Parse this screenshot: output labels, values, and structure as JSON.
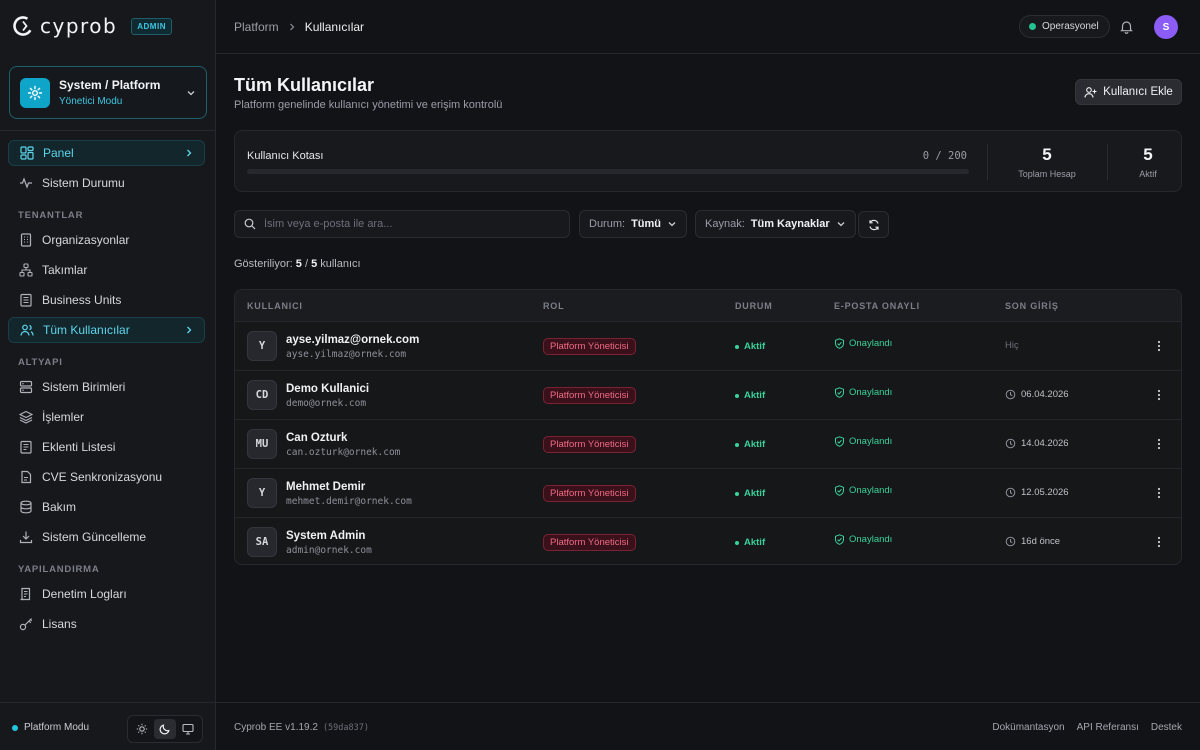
{
  "brand": {
    "name": "cyprob",
    "badge": "ADMIN"
  },
  "context": {
    "title": "System / Platform",
    "subtitle": "Yönetici Modu",
    "icon": "gear-icon"
  },
  "nav": {
    "panel": "Panel",
    "system_status": "Sistem Durumu",
    "sections": {
      "tenants": "TENANTLAR",
      "infra": "ALTYAPI",
      "config": "YAPILANDIRMA"
    },
    "organizations": "Organizasyonlar",
    "teams": "Takımlar",
    "business_units": "Business Units",
    "all_users": "Tüm Kullanıcılar",
    "system_units": "Sistem Birimleri",
    "jobs": "İşlemler",
    "plugins": "Eklenti Listesi",
    "cve_sync": "CVE Senkronizasyonu",
    "maintenance": "Bakım",
    "system_update": "Sistem Güncelleme",
    "audit_logs": "Denetim Logları",
    "license": "Lisans"
  },
  "sidebar_footer": {
    "mode": "Platform Modu",
    "theme_selected": "dark"
  },
  "header": {
    "breadcrumb": [
      "Platform",
      "Kullanıcılar"
    ],
    "status": "Operasyonel",
    "status_color": "#22c38e",
    "avatar_initial": "S"
  },
  "page": {
    "title": "Tüm Kullanıcılar",
    "subtitle": "Platform genelinde kullanıcı yönetimi ve erişim kontrolü",
    "add_button": "Kullanıcı Ekle"
  },
  "quota": {
    "label": "Kullanıcı Kotası",
    "value_text": "0 / 200",
    "used": 0,
    "limit": 200,
    "total_label": "Toplam Hesap",
    "total": "5",
    "active_label": "Aktif",
    "active": "5"
  },
  "filters": {
    "search_placeholder": "İsim veya e-posta ile ara...",
    "status_label": "Durum:",
    "status_value": "Tümü",
    "source_label": "Kaynak:",
    "source_value": "Tüm Kaynaklar"
  },
  "showing": {
    "prefix": "Gösteriliyor:",
    "shown": "5",
    "sep": "/",
    "total": "5",
    "suffix": "kullanıcı"
  },
  "table": {
    "headers": [
      "KULLANICI",
      "ROL",
      "DURUM",
      "E-POSTA ONAYLI",
      "SON GİRİŞ"
    ],
    "rows": [
      {
        "initials": "Y",
        "name": "ayse.yilmaz@ornek.com",
        "email": "ayse.yilmaz@ornek.com",
        "role": "Platform Yöneticisi",
        "status": "Aktif",
        "verified": "Onaylandı",
        "last_login": "Hiç"
      },
      {
        "initials": "CD",
        "name": "Demo Kullanici",
        "email": "demo@ornek.com",
        "role": "Platform Yöneticisi",
        "status": "Aktif",
        "verified": "Onaylandı",
        "last_login": "06.04.2026"
      },
      {
        "initials": "MU",
        "name": "Can Ozturk",
        "email": "can.ozturk@ornek.com",
        "role": "Platform Yöneticisi",
        "status": "Aktif",
        "verified": "Onaylandı",
        "last_login": "14.04.2026"
      },
      {
        "initials": "Y",
        "name": "Mehmet Demir",
        "email": "mehmet.demir@ornek.com",
        "role": "Platform Yöneticisi",
        "status": "Aktif",
        "verified": "Onaylandı",
        "last_login": "12.05.2026"
      },
      {
        "initials": "SA",
        "name": "System Admin",
        "email": "admin@ornek.com",
        "role": "Platform Yöneticisi",
        "status": "Aktif",
        "verified": "Onaylandı",
        "last_login": "16d önce"
      }
    ]
  },
  "footer": {
    "version": "Cyprob EE v1.19.2",
    "hash": "(59da837)",
    "links": [
      "Dokümantasyon",
      "API Referansı",
      "Destek"
    ]
  }
}
